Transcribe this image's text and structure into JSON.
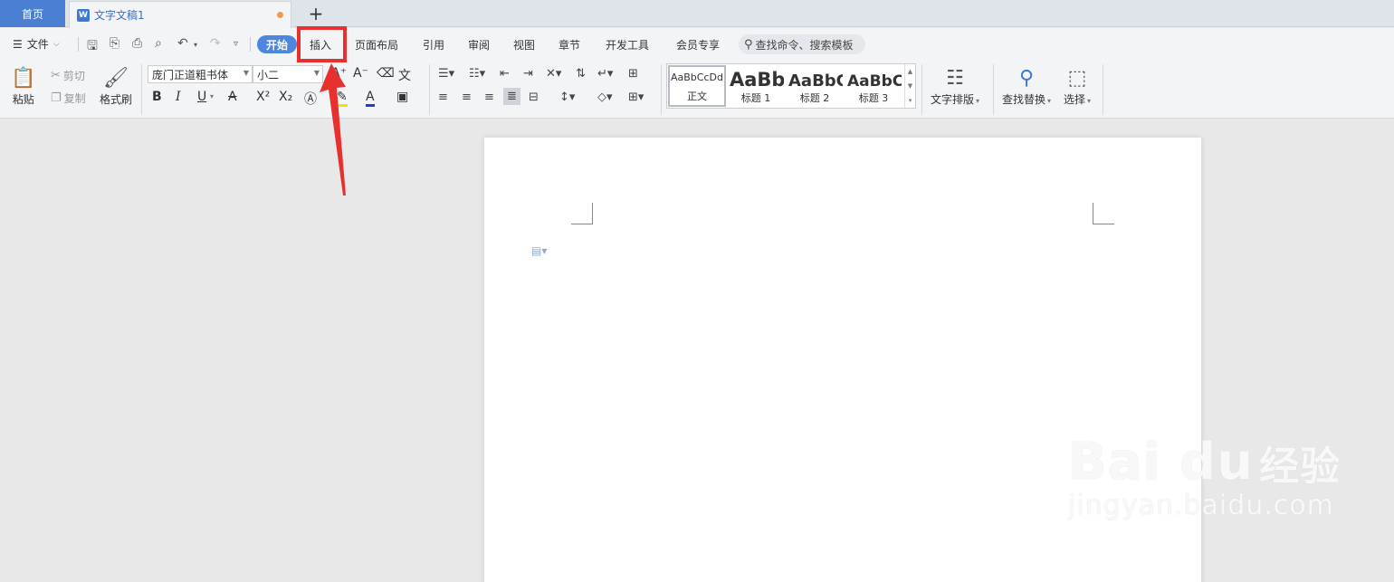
{
  "tabs": {
    "home": "首页",
    "doc_badge": "W",
    "doc_title": "文字文稿1",
    "add": "+"
  },
  "menu": {
    "file": "文件",
    "start": "开始",
    "items": [
      "插入",
      "页面布局",
      "引用",
      "审阅",
      "视图",
      "章节",
      "开发工具",
      "会员专享"
    ],
    "search": "查找命令、搜索模板"
  },
  "ribbon": {
    "paste": "粘贴",
    "cut": "剪切",
    "copy": "复制",
    "format_painter": "格式刷",
    "font_name": "庞门正道粗书体",
    "font_size": "小二",
    "bold": "B",
    "italic": "I",
    "underline": "U",
    "font_color_letter": "A",
    "styles": [
      {
        "sample": "AaBbCcDd",
        "label": "正文"
      },
      {
        "sample": "AaBb",
        "label": "标题 1"
      },
      {
        "sample": "AaBbC",
        "label": "标题 2"
      },
      {
        "sample": "AaBbCc",
        "label": "标题 3"
      }
    ],
    "text_layout": "文字排版",
    "find_replace": "查找替换",
    "select": "选择"
  },
  "watermark": {
    "logo_latin": "Bai du",
    "logo_cn": "经验",
    "url": "jingyan.baidu.com"
  },
  "colors": {
    "accent": "#4d86dd",
    "highlight_box": "#e8312f"
  }
}
